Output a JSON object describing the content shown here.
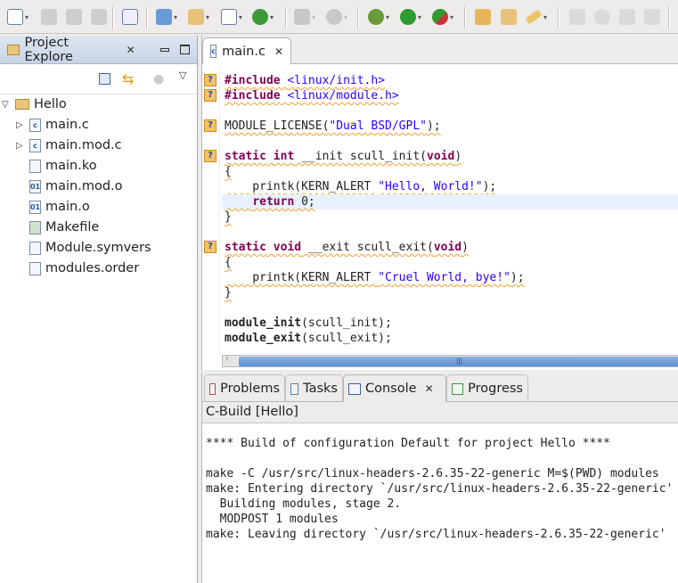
{
  "toolbar": {
    "icons": [
      "new-icon",
      "save-icon",
      "save-all-icon",
      "print-icon",
      "binary-icon",
      "new-c-project-icon",
      "new-source-folder-icon",
      "new-c-file-icon",
      "new-class-icon",
      "build-icon",
      "settings-icon",
      "debug-icon",
      "run-icon",
      "external-tools-icon",
      "open-type-icon",
      "open-element-icon",
      "search-icon",
      "mark-occurrences-icon",
      "toggle-icon",
      "block-selection-icon",
      "show-whitespace-icon"
    ]
  },
  "project_explorer": {
    "title": "Project Explore",
    "tree": [
      {
        "label": "Hello",
        "level": 0,
        "expanded": true,
        "icon": "project-folder-icon"
      },
      {
        "label": "main.c",
        "level": 1,
        "expandable": true,
        "icon": "c-file-icon"
      },
      {
        "label": "main.mod.c",
        "level": 1,
        "expandable": true,
        "icon": "c-file-icon"
      },
      {
        "label": "main.ko",
        "level": 1,
        "icon": "file-icon"
      },
      {
        "label": "main.mod.o",
        "level": 1,
        "icon": "binary-file-icon"
      },
      {
        "label": "main.o",
        "level": 1,
        "icon": "binary-file-icon"
      },
      {
        "label": "Makefile",
        "level": 1,
        "icon": "makefile-icon"
      },
      {
        "label": "Module.symvers",
        "level": 1,
        "icon": "file-icon"
      },
      {
        "label": "modules.order",
        "level": 1,
        "icon": "file-icon"
      }
    ]
  },
  "editor": {
    "tab": "main.c",
    "lines": [
      {
        "m": true,
        "tokens": [
          {
            "c": "kw",
            "s": "#include"
          },
          {
            "c": "",
            "s": " "
          },
          {
            "c": "str",
            "s": "<linux/init.h>"
          }
        ]
      },
      {
        "m": true,
        "tokens": [
          {
            "c": "kw",
            "s": "#include"
          },
          {
            "c": "",
            "s": " "
          },
          {
            "c": "str",
            "s": "<linux/module.h>"
          }
        ]
      },
      {
        "tokens": []
      },
      {
        "m": true,
        "tokens": [
          {
            "c": "",
            "s": "MODULE_LICENSE("
          },
          {
            "c": "str",
            "s": "\"Dual BSD/GPL\""
          },
          {
            "c": "",
            "s": ");"
          }
        ]
      },
      {
        "tokens": []
      },
      {
        "m": true,
        "tokens": [
          {
            "c": "kw",
            "s": "static"
          },
          {
            "c": "",
            "s": " "
          },
          {
            "c": "kw",
            "s": "int"
          },
          {
            "c": "",
            "s": " __init scull_init("
          },
          {
            "c": "kw",
            "s": "void"
          },
          {
            "c": "",
            "s": ")"
          }
        ]
      },
      {
        "tokens": [
          {
            "c": "",
            "s": "{"
          }
        ]
      },
      {
        "tokens": [
          {
            "c": "",
            "s": "    printk(KERN_ALERT "
          },
          {
            "c": "str",
            "s": "\"Hello, World!\""
          },
          {
            "c": "",
            "s": ");"
          }
        ]
      },
      {
        "hl": true,
        "tokens": [
          {
            "c": "",
            "s": "    "
          },
          {
            "c": "kw",
            "s": "return"
          },
          {
            "c": "",
            "s": " 0;"
          }
        ]
      },
      {
        "tokens": [
          {
            "c": "",
            "s": "}"
          }
        ]
      },
      {
        "tokens": []
      },
      {
        "m": true,
        "tokens": [
          {
            "c": "kw",
            "s": "static"
          },
          {
            "c": "",
            "s": " "
          },
          {
            "c": "kw",
            "s": "void"
          },
          {
            "c": "",
            "s": " __exit scull_exit("
          },
          {
            "c": "kw",
            "s": "void"
          },
          {
            "c": "",
            "s": ")"
          }
        ]
      },
      {
        "tokens": [
          {
            "c": "",
            "s": "{"
          }
        ]
      },
      {
        "tokens": [
          {
            "c": "",
            "s": "    printk(KERN_ALERT "
          },
          {
            "c": "str",
            "s": "\"Cruel World, bye!\""
          },
          {
            "c": "",
            "s": ");"
          }
        ]
      },
      {
        "tokens": [
          {
            "c": "",
            "s": "}"
          }
        ]
      },
      {
        "tokens": []
      },
      {
        "nou": true,
        "tokens": [
          {
            "c": "bold",
            "s": "module_init"
          },
          {
            "c": "",
            "s": "(scull_init);"
          }
        ]
      },
      {
        "nou": true,
        "tokens": [
          {
            "c": "bold",
            "s": "module_exit"
          },
          {
            "c": "",
            "s": "(scull_exit);"
          }
        ]
      }
    ],
    "marker": "?"
  },
  "bottom": {
    "tabs": [
      {
        "label": "Problems",
        "icon": "problems-icon"
      },
      {
        "label": "Tasks",
        "icon": "tasks-icon"
      },
      {
        "label": "Console",
        "icon": "console-icon",
        "active": true
      },
      {
        "label": "Progress",
        "icon": "progress-icon"
      }
    ],
    "console_title": "C-Build [Hello]",
    "console_lines": [
      "**** Build of configuration Default for project Hello ****",
      "",
      "make -C /usr/src/linux-headers-2.6.35-22-generic M=$(PWD) modules",
      "make: Entering directory `/usr/src/linux-headers-2.6.35-22-generic'",
      "  Building modules, stage 2.",
      "  MODPOST 1 modules",
      "make: Leaving directory `/usr/src/linux-headers-2.6.35-22-generic'"
    ]
  },
  "colors": {
    "keyword": "#7f0055",
    "string": "#2a00ff",
    "current_line": "#e8f2fe",
    "marker": "#f5c26b"
  }
}
